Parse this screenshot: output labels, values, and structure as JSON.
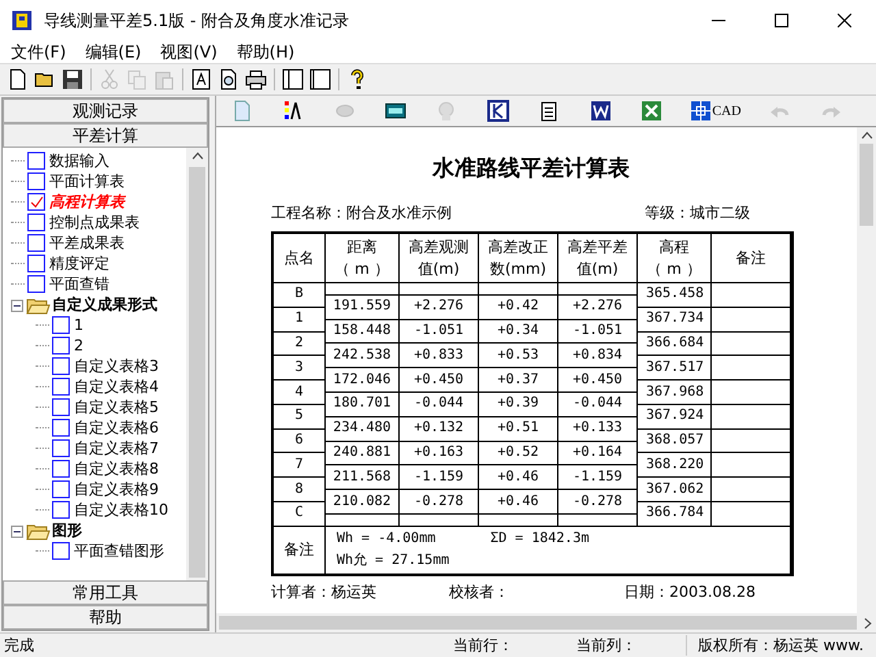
{
  "window": {
    "title": "导线测量平差5.1版 - 附合及角度水准记录"
  },
  "menu": [
    "文件(F)",
    "编辑(E)",
    "视图(V)",
    "帮助(H)"
  ],
  "toolbar": [
    {
      "kind": "new",
      "disabled": false
    },
    {
      "kind": "open",
      "disabled": false
    },
    {
      "kind": "save",
      "disabled": false
    },
    {
      "kind": "sep"
    },
    {
      "kind": "cut",
      "disabled": true
    },
    {
      "kind": "copy",
      "disabled": true
    },
    {
      "kind": "paste",
      "disabled": true
    },
    {
      "kind": "sep"
    },
    {
      "kind": "textdoc",
      "disabled": false
    },
    {
      "kind": "preview",
      "disabled": false
    },
    {
      "kind": "print",
      "disabled": false
    },
    {
      "kind": "sep"
    },
    {
      "kind": "panel-left",
      "disabled": false
    },
    {
      "kind": "panel",
      "disabled": false
    },
    {
      "kind": "sep"
    },
    {
      "kind": "help",
      "disabled": false
    }
  ],
  "sidebar": {
    "sections_top": [
      {
        "label": "观测记录"
      },
      {
        "label": "平差计算"
      }
    ],
    "tree": [
      {
        "kind": "check",
        "label": "数据输入",
        "checked": false
      },
      {
        "kind": "check",
        "label": "平面计算表",
        "checked": false
      },
      {
        "kind": "check",
        "label": "高程计算表",
        "checked": true
      },
      {
        "kind": "check",
        "label": "控制点成果表",
        "checked": false
      },
      {
        "kind": "check",
        "label": "平差成果表",
        "checked": false
      },
      {
        "kind": "check",
        "label": "精度评定",
        "checked": false
      },
      {
        "kind": "check",
        "label": "平面查错",
        "checked": false
      },
      {
        "kind": "folder",
        "label": "自定义成果形式",
        "expanded": true,
        "children": [
          {
            "kind": "check",
            "label": "1",
            "checked": false
          },
          {
            "kind": "check",
            "label": "2",
            "checked": false
          },
          {
            "kind": "check",
            "label": "自定义表格3",
            "checked": false
          },
          {
            "kind": "check",
            "label": "自定义表格4",
            "checked": false
          },
          {
            "kind": "check",
            "label": "自定义表格5",
            "checked": false
          },
          {
            "kind": "check",
            "label": "自定义表格6",
            "checked": false
          },
          {
            "kind": "check",
            "label": "自定义表格7",
            "checked": false
          },
          {
            "kind": "check",
            "label": "自定义表格8",
            "checked": false
          },
          {
            "kind": "check",
            "label": "自定义表格9",
            "checked": false
          },
          {
            "kind": "check",
            "label": "自定义表格10",
            "checked": false
          }
        ]
      },
      {
        "kind": "folder",
        "label": "图形",
        "expanded": true,
        "children": [
          {
            "kind": "check",
            "label": "平面查错图形",
            "checked": false
          }
        ]
      }
    ],
    "sections_bottom": [
      {
        "label": "常用工具"
      },
      {
        "label": "帮助"
      }
    ]
  },
  "doc_toolbar": [
    {
      "kind": "page",
      "disabled": false
    },
    {
      "kind": "colors",
      "disabled": false
    },
    {
      "kind": "disc",
      "disabled": true
    },
    {
      "kind": "keyboard",
      "disabled": false
    },
    {
      "kind": "head",
      "disabled": true
    },
    {
      "kind": "k",
      "disabled": false
    },
    {
      "kind": "notepad",
      "disabled": false
    },
    {
      "kind": "word",
      "disabled": false
    },
    {
      "kind": "excel",
      "disabled": false
    },
    {
      "kind": "cad",
      "disabled": false,
      "label": "CAD"
    },
    {
      "kind": "undo",
      "disabled": true
    },
    {
      "kind": "redo",
      "disabled": true
    }
  ],
  "document": {
    "title": "水准路线平差计算表",
    "project": "工程名称：附合及水准示例",
    "grade": "等级：城市二级",
    "columns": [
      [
        "点名"
      ],
      [
        "距离",
        "（ m ）"
      ],
      [
        "高差观测",
        "值(m)"
      ],
      [
        "高差改正",
        "数(mm)"
      ],
      [
        "高差平差",
        "值(m)"
      ],
      [
        "高程",
        "（ m ）"
      ],
      [
        "备注"
      ]
    ],
    "points": [
      {
        "name": "B",
        "elevation": "365.458"
      },
      {
        "name": "1",
        "elevation": "367.734"
      },
      {
        "name": "2",
        "elevation": "366.684"
      },
      {
        "name": "3",
        "elevation": "367.517"
      },
      {
        "name": "4",
        "elevation": "367.968"
      },
      {
        "name": "5",
        "elevation": "367.924"
      },
      {
        "name": "6",
        "elevation": "368.057"
      },
      {
        "name": "7",
        "elevation": "368.220"
      },
      {
        "name": "8",
        "elevation": "367.062"
      },
      {
        "name": "C",
        "elevation": "366.784"
      }
    ],
    "intervals": [
      [
        "191.559",
        "+2.276",
        "+0.42",
        "+2.276"
      ],
      [
        "158.448",
        "-1.051",
        "+0.34",
        "-1.051"
      ],
      [
        "242.538",
        "+0.833",
        "+0.53",
        "+0.834"
      ],
      [
        "172.046",
        "+0.450",
        "+0.37",
        "+0.450"
      ],
      [
        "180.701",
        "-0.044",
        "+0.39",
        "-0.044"
      ],
      [
        "234.480",
        "+0.132",
        "+0.51",
        "+0.133"
      ],
      [
        "240.881",
        "+0.163",
        "+0.52",
        "+0.164"
      ],
      [
        "211.568",
        "-1.159",
        "+0.46",
        "-1.159"
      ],
      [
        "210.082",
        "-0.278",
        "+0.46",
        "-0.278"
      ]
    ],
    "remark": {
      "label": "备注",
      "line1": [
        "Wh = -4.00mm",
        "ΣD = 1842.3m"
      ],
      "line2": "Wh允 = 27.15mm"
    },
    "footer": [
      "计算者：杨运英",
      "校核者：",
      "日期：2003.08.28"
    ]
  },
  "status_bar": [
    "完成",
    "当前行：",
    "当前列：",
    "版权所有：杨运英 www."
  ]
}
